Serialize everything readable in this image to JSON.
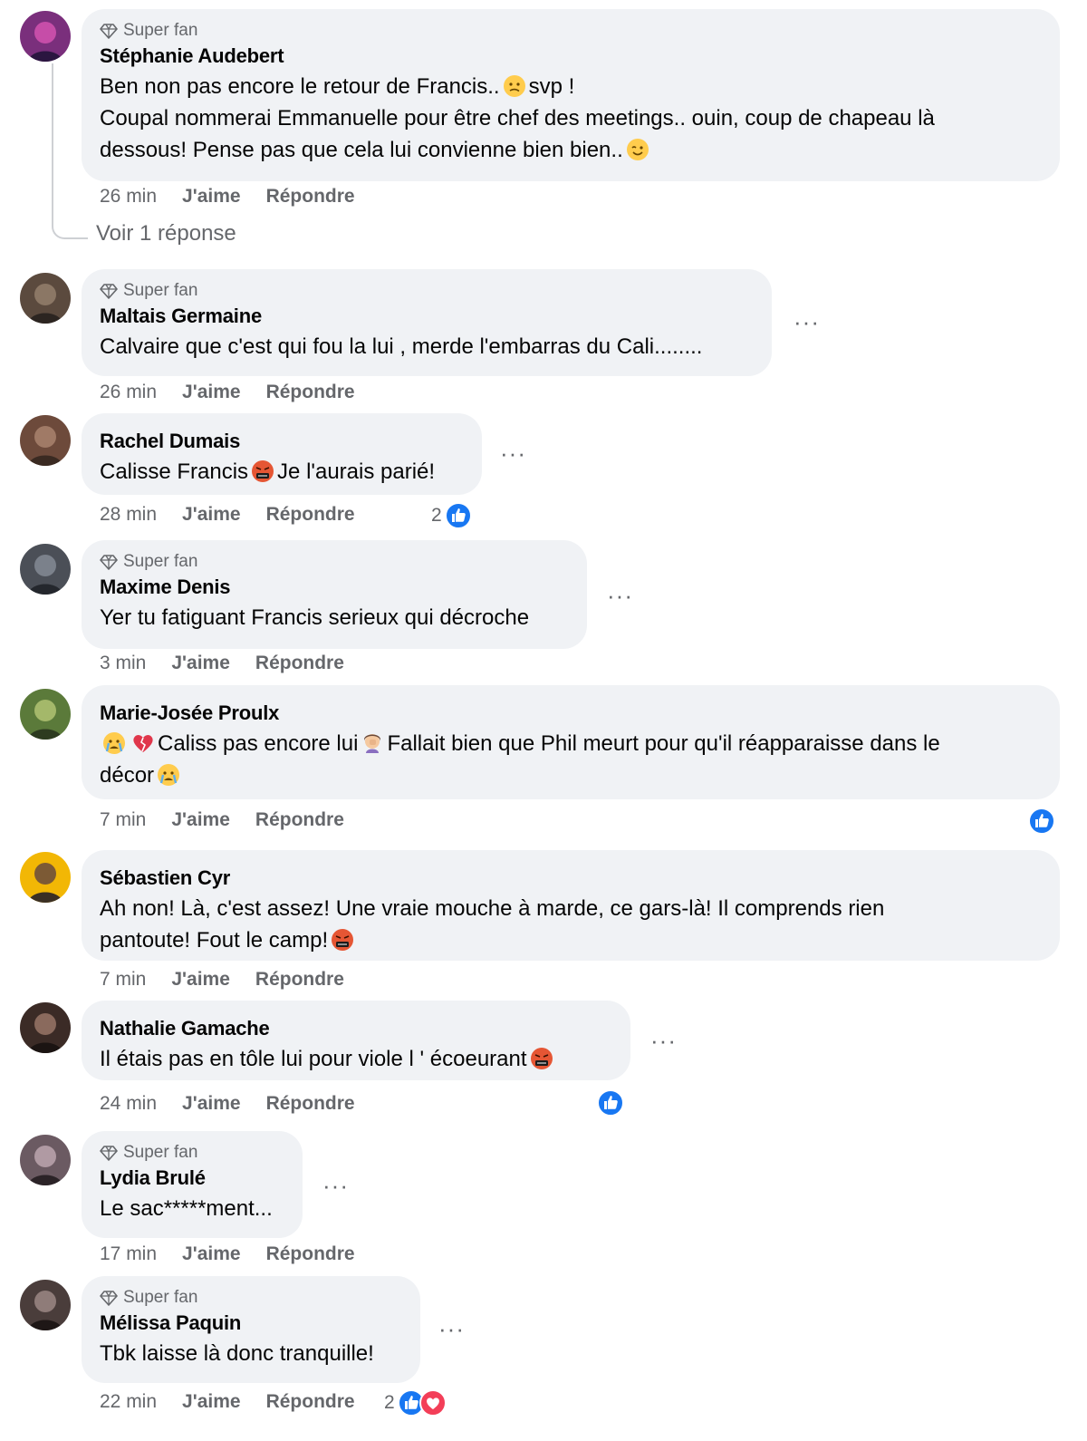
{
  "badge_label": "Super fan",
  "labels": {
    "like": "J'aime",
    "reply": "Répondre",
    "more": "···"
  },
  "colors": {
    "bubble": "#f0f2f5",
    "muted": "#65676b",
    "like_blue": "#1877f2",
    "love_red": "#f33e58"
  },
  "comments": [
    {
      "name": "Stéphanie Audebert",
      "super_fan": true,
      "lines": [
        [
          "Ben non pas encore le retour de Francis..",
          "emoji:confused-face-icon",
          "svp !"
        ],
        [
          "Coupal nommerai Emmanuelle pour être chef des meetings.. ouin, coup de chapeau là"
        ],
        [
          "dessous! Pense pas que cela lui convienne bien bien..",
          "emoji:wink-face-icon"
        ]
      ],
      "time": "26 min",
      "view_replies": "Voir 1 réponse"
    },
    {
      "name": "Maltais Germaine",
      "super_fan": true,
      "lines": [
        [
          "Calvaire que c'est qui fou la lui , merde l'embarras du Cali........"
        ]
      ],
      "time": "26 min"
    },
    {
      "name": "Rachel Dumais",
      "super_fan": false,
      "lines": [
        [
          "Calisse Francis",
          "emoji:angry-cursing-face-icon",
          "Je l'aurais parié!"
        ]
      ],
      "time": "28 min",
      "reactions": {
        "count": "2",
        "types": [
          "like"
        ]
      }
    },
    {
      "name": "Maxime Denis",
      "super_fan": true,
      "lines": [
        [
          "Yer tu fatiguant Francis serieux qui décroche"
        ]
      ],
      "time": "3 min"
    },
    {
      "name": "Marie-Josée Proulx",
      "super_fan": false,
      "lines": [
        [
          "emoji:crying-face-icon",
          "emoji:broken-heart-icon",
          "Caliss pas encore lui",
          "emoji:woman-facepalming-icon",
          "Fallait bien que Phil meurt pour qu'il réapparaisse dans le"
        ],
        [
          "décor",
          "emoji:crying-face-icon"
        ]
      ],
      "time": "7 min",
      "reactions": {
        "count": "",
        "types": [
          "like"
        ]
      }
    },
    {
      "name": "Sébastien Cyr",
      "super_fan": false,
      "lines": [
        [
          "Ah non! Là, c'est assez! Une vraie mouche à marde, ce gars-là! Il comprends rien"
        ],
        [
          "pantoute! Fout le camp!",
          "emoji:angry-cursing-face-icon"
        ]
      ],
      "time": "7 min"
    },
    {
      "name": "Nathalie Gamache",
      "super_fan": false,
      "lines": [
        [
          "Il étais pas en tôle lui pour viole l ' écoeurant",
          "emoji:angry-cursing-face-icon"
        ]
      ],
      "time": "24 min",
      "reactions": {
        "count": "",
        "types": [
          "like"
        ]
      }
    },
    {
      "name": "Lydia Brulé",
      "super_fan": true,
      "lines": [
        [
          "Le sac*****ment..."
        ]
      ],
      "time": "17 min"
    },
    {
      "name": "Mélissa Paquin",
      "super_fan": true,
      "lines": [
        [
          "Tbk laisse là donc tranquille!"
        ]
      ],
      "time": "22 min",
      "reactions": {
        "count": "2",
        "types": [
          "like",
          "love"
        ]
      }
    }
  ]
}
